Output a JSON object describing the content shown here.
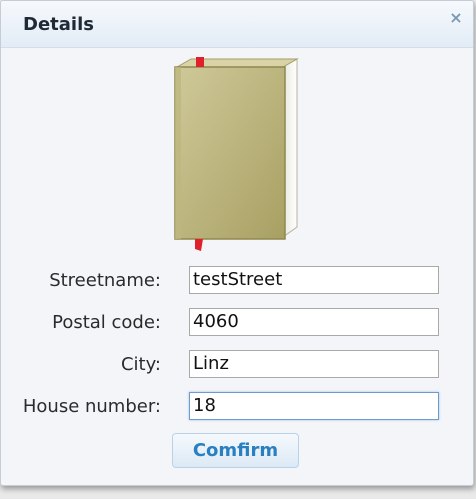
{
  "dialog": {
    "title": "Details",
    "close_symbol": "×"
  },
  "form": {
    "streetname": {
      "label": "Streetname:",
      "value": "testStreet"
    },
    "postal_code": {
      "label": "Postal code:",
      "value": "4060"
    },
    "city": {
      "label": "City:",
      "value": "Linz"
    },
    "house_number": {
      "label": "House number:",
      "value": "18"
    }
  },
  "actions": {
    "confirm_label": "Comfirm"
  },
  "icons": {
    "book": "book-icon",
    "close": "close-icon"
  }
}
